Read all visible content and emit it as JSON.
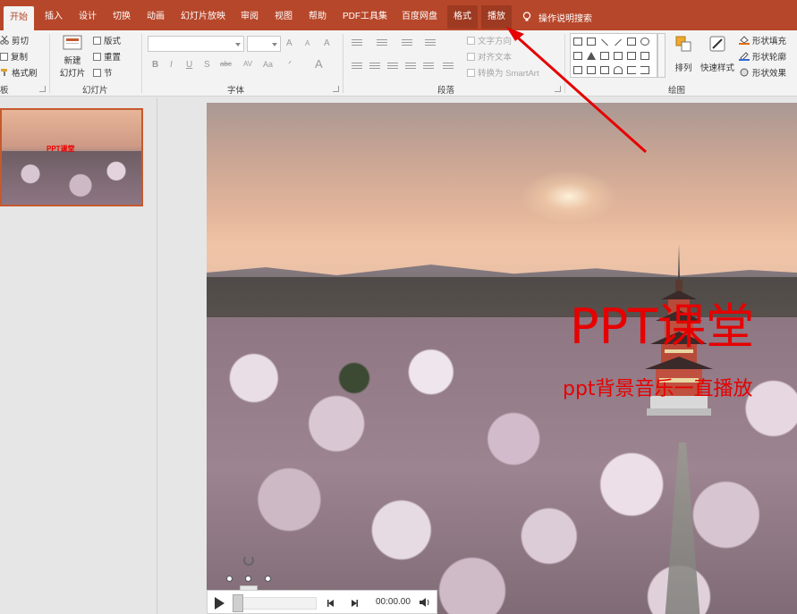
{
  "tabs": [
    {
      "label": "开始",
      "active": true
    },
    {
      "label": "插入"
    },
    {
      "label": "设计"
    },
    {
      "label": "切换"
    },
    {
      "label": "动画"
    },
    {
      "label": "幻灯片放映"
    },
    {
      "label": "审阅"
    },
    {
      "label": "视图"
    },
    {
      "label": "帮助"
    },
    {
      "label": "PDF工具集"
    },
    {
      "label": "百度网盘"
    },
    {
      "label": "格式"
    },
    {
      "label": "播放"
    }
  ],
  "search_label": "操作说明搜索",
  "ribbon": {
    "clipboard": {
      "cut": "剪切",
      "copy": "复制",
      "painter": "格式刷",
      "label": "板"
    },
    "slides": {
      "new_slide_1": "新建",
      "new_slide_2": "幻灯片",
      "layout": "版式",
      "reset": "重置",
      "section": "节",
      "label": "幻灯片"
    },
    "font": {
      "label": "字体",
      "bold": "B",
      "italic": "I",
      "underline": "U",
      "shadow": "S",
      "strike": "abc",
      "spacing": "AV",
      "case": "Aa",
      "grow": "A",
      "shrink": "A",
      "clear": "A",
      "color": "A"
    },
    "paragraph": {
      "label": "段落",
      "text_dir": "文字方向",
      "align_text": "对齐文本",
      "smartart": "转换为 SmartArt"
    },
    "drawing": {
      "label": "绘图",
      "arrange": "排列",
      "quick_styles": "快速样式",
      "fill": "形状填充",
      "outline": "形状轮廓",
      "effects": "形状效果"
    }
  },
  "slide": {
    "title": "PPT课堂",
    "subtitle": "ppt背景音乐一直播放"
  },
  "player": {
    "time": "00:00.00"
  },
  "colors": {
    "accent": "#b7472a",
    "title_red": "#e60000"
  }
}
